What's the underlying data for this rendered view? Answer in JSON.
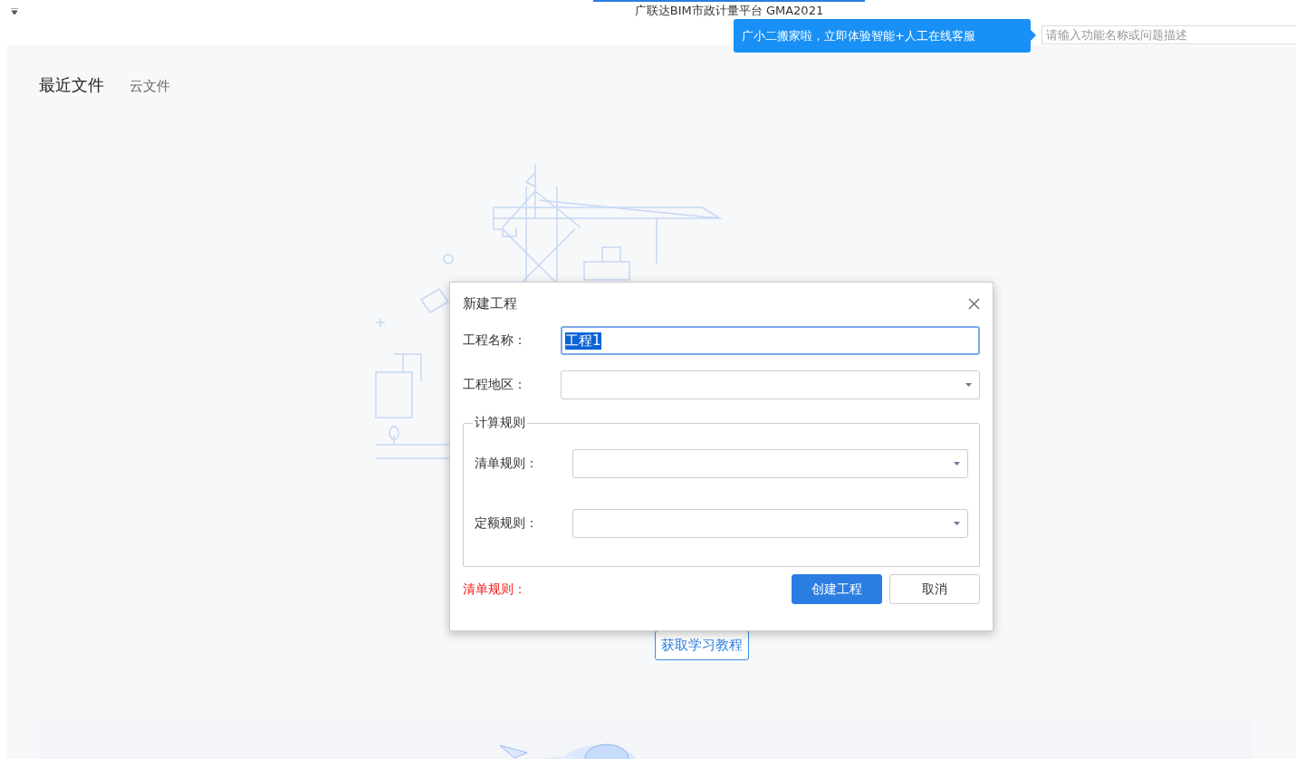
{
  "window": {
    "title": "广联达BIM市政计量平台 GMA2021"
  },
  "help": {
    "tooltip": "广小二搬家啦，立即体验智能+人工在线客服",
    "search_placeholder": "请输入功能名称或问题描述"
  },
  "tabs": [
    {
      "label": "最近文件",
      "selected": true
    },
    {
      "label": "云文件",
      "selected": false
    }
  ],
  "tutorial_button": "获取学习教程",
  "dialog": {
    "title": "新建工程",
    "fields": [
      {
        "label": "工程名称：",
        "kind": "text",
        "value": "工程1",
        "text_selected": true
      },
      {
        "label": "工程地区：",
        "kind": "select"
      }
    ],
    "group": {
      "title": "计算规则",
      "fields": [
        {
          "label": "清单规则：",
          "kind": "select"
        },
        {
          "label": "定额规则：",
          "kind": "select"
        }
      ]
    },
    "error": "清单规则：",
    "buttons": [
      {
        "label": "创建工程",
        "kind": "primary"
      },
      {
        "label": "取消",
        "kind": "default"
      }
    ]
  }
}
